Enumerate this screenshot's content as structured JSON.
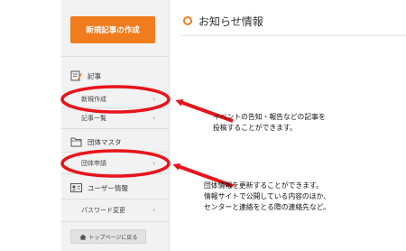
{
  "sidebar": {
    "new_article_button": "新規記事の作成",
    "articles_label": "記事",
    "new_post_label": "新規作成",
    "article_list_label": "記事一覧",
    "group_master_label": "団体マスタ",
    "group_apply_label": "団体申請",
    "user_info_label": "ユーザー情報",
    "password_change_label": "パスワード変更",
    "back_to_top_label": "トップページに戻る",
    "chevron": "›"
  },
  "main": {
    "title": "お知らせ情報"
  },
  "annotations": {
    "note1": "イベントの告知・報告などの記事を\n投稿することができます。",
    "note2": "団体情報を更新することができます。\n情報サイトで公開している内容のほか、\nセンターと連絡をとる際の連絡先など。"
  },
  "colors": {
    "accent": "#f07c1e",
    "annotation_red": "#e8141b",
    "sidebar_bg": "#f2f2f2"
  }
}
